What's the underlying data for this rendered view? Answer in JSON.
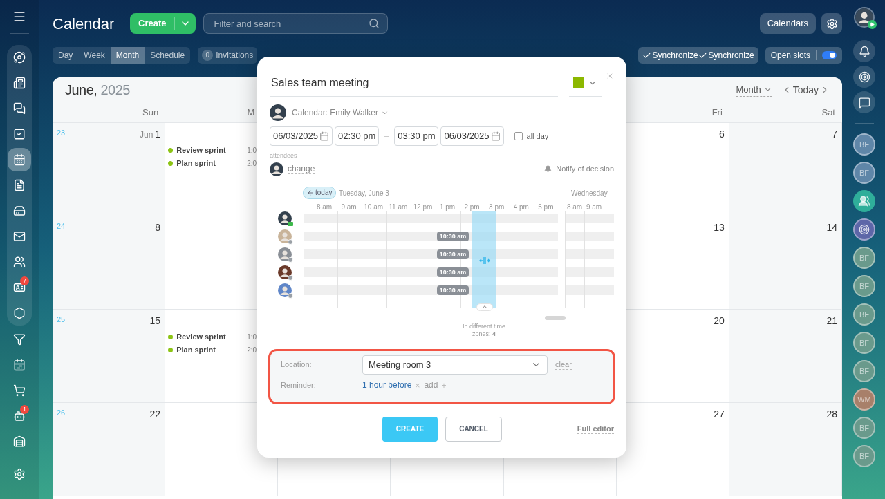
{
  "sidebar": {
    "panel_items": [
      {
        "selected": false
      },
      {
        "selected": false
      },
      {
        "selected": false
      },
      {
        "selected": false
      },
      {
        "selected": true
      },
      {
        "selected": false
      },
      {
        "selected": false
      },
      {
        "selected": false
      },
      {
        "selected": false
      },
      {
        "selected": false,
        "badge": "7"
      },
      {
        "selected": false
      }
    ],
    "items": [
      {
        "selected": false
      },
      {
        "selected": false
      },
      {
        "selected": false
      },
      {
        "selected": false,
        "badge": "1"
      },
      {
        "selected": false
      },
      {
        "selected": false
      }
    ]
  },
  "header": {
    "title": "Calendar",
    "create_button": "Create",
    "search": {
      "placeholder": "Filter and search"
    },
    "calendars_button": "Calendars"
  },
  "view_tabs": [
    {
      "label": "Day",
      "selected": false
    },
    {
      "label": "Week",
      "selected": false
    },
    {
      "label": "Month",
      "selected": true
    },
    {
      "label": "Schedule",
      "selected": false
    }
  ],
  "invitations": {
    "count": "0",
    "label": "Invitations"
  },
  "sync_button": {
    "labels": [
      "Synchronize",
      "Synchronize"
    ]
  },
  "open_slots": {
    "label": "Open slots",
    "on": true
  },
  "calendar": {
    "month": "June,",
    "year": "2025",
    "view_select": "Month",
    "today_button": "Today",
    "day_headers": {
      "sun": "Sun",
      "mon": "M",
      "fri": "Fri",
      "sat": "Sat"
    },
    "weeks": [
      {
        "number": "23",
        "sun": {
          "month": "Jun",
          "date": "1"
        },
        "mon": {
          "events": [
            {
              "title": "Review sprint",
              "time": "1:0"
            },
            {
              "title": "Plan sprint",
              "time": "2:0"
            }
          ]
        },
        "fri": {
          "date": "6"
        },
        "sat": {
          "date": "7"
        }
      },
      {
        "number": "24",
        "sun": {
          "date": "8"
        },
        "fri": {
          "date": "13"
        },
        "sat": {
          "date": "14"
        }
      },
      {
        "number": "25",
        "sun": {
          "date": "15"
        },
        "mon": {
          "events": [
            {
              "title": "Review sprint",
              "time": "1:0"
            },
            {
              "title": "Plan sprint",
              "time": "2:0"
            }
          ]
        },
        "fri": {
          "date": "20"
        },
        "sat": {
          "date": "21"
        }
      },
      {
        "number": "26",
        "sun": {
          "date": "22"
        },
        "fri": {
          "date": "27"
        },
        "sat": {
          "date": "28"
        }
      }
    ]
  },
  "event_form": {
    "title": "Sales team meeting",
    "color": "#8cb800",
    "calendar_label": "Calendar: Emily Walker",
    "start_date": "06/03/2025",
    "start_time": "02:30 pm",
    "end_time": "03:30 pm",
    "end_date": "06/03/2025",
    "all_day": {
      "label": "all day",
      "checked": false
    },
    "attendees_label": "attendees",
    "change_link": "change",
    "notify": "Notify of decision",
    "planner": {
      "today_button": "today",
      "day_label": "Tuesday, June 3",
      "next_day_label": "Wednesday",
      "hours": [
        "8 am",
        "9 am",
        "10 am",
        "11 am",
        "12 pm",
        "1 pm",
        "2 pm",
        "3 pm",
        "4 pm",
        "5 pm"
      ],
      "next_day_hours": [
        "8 am",
        "9 am"
      ],
      "attendees": [
        {
          "kind": "organizer"
        },
        {
          "kind": "guest",
          "local_time": "10:30 am"
        },
        {
          "kind": "guest",
          "local_time": "10:30 am"
        },
        {
          "kind": "guest",
          "local_time": "10:30 am"
        },
        {
          "kind": "guest",
          "local_time": "10:30 am"
        }
      ],
      "timezones_note": "In different time zones: **4**"
    },
    "location": {
      "label": "Location:",
      "value": "Meeting room 3",
      "clear": "clear"
    },
    "reminder": {
      "label": "Reminder:",
      "value": "1 hour before",
      "remove": "×",
      "add": "add",
      "add_icon": "+"
    },
    "create_button": "CREATE",
    "cancel_button": "CANCEL",
    "full_editor": "Full editor"
  },
  "right_bar": {
    "contacts": [
      {
        "kind": "initials",
        "initials": "BF",
        "color": "#5f86a8"
      },
      {
        "kind": "initials",
        "initials": "BF",
        "color": "#5f86a8"
      },
      {
        "kind": "group"
      },
      {
        "kind": "app"
      },
      {
        "kind": "initials",
        "initials": "BF",
        "color": "#6a9a8c"
      },
      {
        "kind": "initials",
        "initials": "BF",
        "color": "#6a9a8c"
      },
      {
        "kind": "initials",
        "initials": "BF",
        "color": "#6a9a8c"
      },
      {
        "kind": "initials",
        "initials": "BF",
        "color": "#6a9a8c"
      },
      {
        "kind": "initials",
        "initials": "BF",
        "color": "#6a9a8c"
      },
      {
        "kind": "initials",
        "initials": "WM",
        "color": "#a8806a"
      },
      {
        "kind": "initials",
        "initials": "BF",
        "color": "#6a9a8c"
      },
      {
        "kind": "initials",
        "initials": "BF",
        "color": "#6a9a8c"
      }
    ]
  }
}
